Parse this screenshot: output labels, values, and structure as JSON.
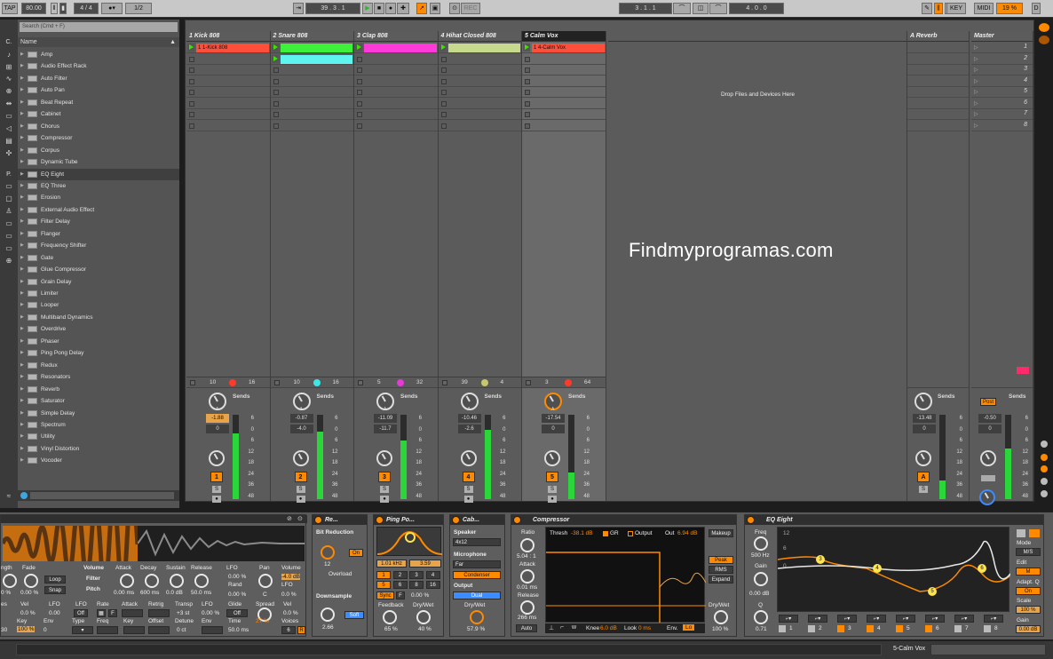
{
  "transport": {
    "tap": "TAP",
    "tempo": "80.00",
    "time_sig": "4 / 4",
    "quantize": "1/2",
    "position": "39 .  3 .  1",
    "rec_label": "REC",
    "loop_start": "3 .  1 .  1",
    "loop_length": "4 .  0 .  0",
    "key": "KEY",
    "midi": "MIDI",
    "cpu": "19 %",
    "d": "D"
  },
  "browser": {
    "search_placeholder": "Search (Cmd + F)",
    "header": "Name",
    "left_labels": [
      "C.",
      "P."
    ],
    "items": [
      "Amp",
      "Audio Effect Rack",
      "Auto Filter",
      "Auto Pan",
      "Beat Repeat",
      "Cabinet",
      "Chorus",
      "Compressor",
      "Corpus",
      "Dynamic Tube",
      "EQ Eight",
      "EQ Three",
      "Erosion",
      "External Audio Effect",
      "Filter Delay",
      "Flanger",
      "Frequency Shifter",
      "Gate",
      "Glue Compressor",
      "Grain Delay",
      "Limiter",
      "Looper",
      "Multiband Dynamics",
      "Overdrive",
      "Phaser",
      "Ping Pong Delay",
      "Redux",
      "Resonators",
      "Reverb",
      "Saturator",
      "Simple Delay",
      "Spectrum",
      "Utility",
      "Vinyl Distortion",
      "Vocoder"
    ],
    "selected": "EQ Eight"
  },
  "tracks": [
    {
      "name": "1 Kick 808",
      "clip": "1 1-Kick 808",
      "clip_color": "#ff4f3a",
      "clip2_color": "",
      "input_a": "10",
      "input_b": "16",
      "dot": "#ff3a2a",
      "vol": "-1.88",
      "pan": "0",
      "num": "1",
      "meter": 0.78
    },
    {
      "name": "2 Snare 808",
      "clip": "",
      "clip_color": "#3ff03a",
      "clip2_color": "#5ef5f0",
      "input_a": "10",
      "input_b": "16",
      "dot": "#3ee6e6",
      "vol": "-0.87",
      "pan": "-4.0",
      "num": "2",
      "meter": 0.8
    },
    {
      "name": "3 Clap 808",
      "clip": "",
      "clip_color": "#ff3ad8",
      "clip2_color": "",
      "input_a": "5",
      "input_b": "32",
      "dot": "#e53ad6",
      "vol": "-11.09",
      "pan": "-11.7",
      "num": "3",
      "meter": 0.7
    },
    {
      "name": "4 Hihat Closed 808",
      "clip": "",
      "clip_color": "#c7d98c",
      "clip2_color": "",
      "input_a": "39",
      "input_b": "4",
      "dot": "#c8c86a",
      "vol": "-10.46",
      "pan": "-2.6",
      "num": "4",
      "meter": 0.82
    },
    {
      "name": "5 Calm Vox",
      "clip": "1 4-Calm Vox",
      "clip_color": "#ff4f3a",
      "clip2_color": "",
      "input_a": "3",
      "input_b": "64",
      "dot": "#ff3a2a",
      "vol": "-17.54",
      "pan": "0",
      "num": "5",
      "meter": 0.32
    }
  ],
  "sends_label": "Sends",
  "drop_text": "Drop Files and Devices Here",
  "return_track": {
    "name": "A Reverb",
    "vol": "-13.48",
    "pan": "0",
    "num": "A",
    "meter": 0.22
  },
  "master": {
    "name": "Master",
    "scenes": [
      "1",
      "2",
      "3",
      "4",
      "5",
      "6",
      "7",
      "8"
    ],
    "vol": "-0.50",
    "pan": "0",
    "post": "Post",
    "meter": 0.6
  },
  "meter_scale": [
    "6",
    "0",
    "6",
    "12",
    "18",
    "24",
    "36",
    "48"
  ],
  "watermark": "Findmyprogramas.com",
  "devices": {
    "sampler": {
      "labels": {
        "length": "ngth",
        "fade": "Fade",
        "volume": "Volume",
        "filter": "Filter",
        "pitch": "Pitch",
        "attack": "Attack",
        "decay": "Decay",
        "sustain": "Sustain",
        "release": "Release",
        "lfo": "LFO",
        "pan": "Pan",
        "volume2": "Volume",
        "rand": "Rand",
        "lfo2": "LFO",
        "loop": "Loop",
        "snap": "Snap",
        "vel": "Vel",
        "lfo3": "LFO",
        "rate": "Rate",
        "retrig": "Retrig",
        "transp": "Transp",
        "glide": "Glide",
        "spread": "Spread",
        "vel2": "Vel",
        "key": "Key",
        "env": "Env",
        "type": "Type",
        "freq": "Freq",
        "key2": "Key",
        "offset": "Offset",
        "detune": "Detune",
        "env2": "Env",
        "time": "Time",
        "voices": "Voices",
        "es": "es"
      },
      "values": {
        "pct": "0 %",
        "fade": "0.00 %",
        "attack": "0.00 ms",
        "decay": "600 ms",
        "sustain": "0.0 dB",
        "release": "50.0 ms",
        "lfo": "0.0 %",
        "lfo_pan": "0.00 %",
        "pan": "C",
        "vol_db": "-4.0 dB",
        "rand": "0.00 %",
        "vel": "0.0 %",
        "lfo3": "0.00",
        "off": "Off",
        "f": "F",
        "st": "+3 st",
        "glide_pct": "0.00 %",
        "glide": "Off",
        "spread": "27 %",
        "vel2": "0.0 %",
        "n30": "30",
        "k100": "100 %",
        "zero": "0",
        "ct": "0 ct",
        "time": "50.0 ms",
        "voices": "6",
        "r": "R"
      }
    },
    "redux": {
      "title": "Re...",
      "bit_reduction": "Bit Reduction",
      "bits": "12",
      "on": "On",
      "overload": "Overload",
      "downsample": "Downsample",
      "ds": "2.66",
      "soft": "Soft"
    },
    "pingpong": {
      "title": "Ping Po...",
      "freq": "1.01 kHz",
      "q": "3.59",
      "nums1": [
        "1",
        "2",
        "3",
        "4"
      ],
      "nums2": [
        "5",
        "6",
        "8",
        "16"
      ],
      "sync": "Sync",
      "f": "F",
      "pct": "0.00 %",
      "feedback": "Feedback",
      "drywet": "Dry/Wet",
      "fb_val": "65 %",
      "dw_val": "40 %"
    },
    "cabinet": {
      "title": "Cab...",
      "speaker": "Speaker",
      "speaker_val": "4x12",
      "microphone": "Microphone",
      "mic_val": "Far",
      "mic_type": "Condenser",
      "output": "Output",
      "output_val": "Dual",
      "drywet": "Dry/Wet",
      "dw_val": "57.9 %"
    },
    "compressor": {
      "title": "Compressor",
      "ratio": "Ratio",
      "ratio_val": "5.04 : 1",
      "attack": "Attack",
      "attack_val": "0.01 ms",
      "release": "Release",
      "release_val": "266 ms",
      "auto": "Auto",
      "thresh": "Thresh",
      "thresh_val": "-38.1 dB",
      "gr": "GR",
      "output_lbl": "Output",
      "out": "Out",
      "out_val": "6.94 dB",
      "knee": "Knee",
      "knee_val": "6.0 dB",
      "look": "Look",
      "look_val": "0 ms",
      "env": "Env.",
      "env_val": "Lo",
      "makeup": "Makeup",
      "peak": "Peak",
      "rms": "RMS",
      "expand": "Expand",
      "drywet": "Dry/Wet",
      "dw_val": "100 %"
    },
    "eq8": {
      "title": "EQ Eight",
      "freq": "Freq",
      "freq_val": "500 Hz",
      "gain": "Gain",
      "gain_val": "0.00 dB",
      "q": "Q",
      "q_val": "0.71",
      "mode": "Mode",
      "mode_val": "M/S",
      "edit": "Edit",
      "edit_val": "M",
      "adapt": "Adapt. Q",
      "adapt_val": "On",
      "scale": "Scale",
      "scale_val": "100 %",
      "gain2": "Gain",
      "gain2_val": "0.00 dB",
      "bands": [
        "1",
        "2",
        "3",
        "4",
        "5",
        "6",
        "7",
        "8"
      ],
      "nodes": [
        "3",
        "4",
        "5",
        "6"
      ],
      "scale_top": "12",
      "scale_mid": "6",
      "scale_zero": "0"
    }
  },
  "status": {
    "track": "5-Calm Vox"
  }
}
